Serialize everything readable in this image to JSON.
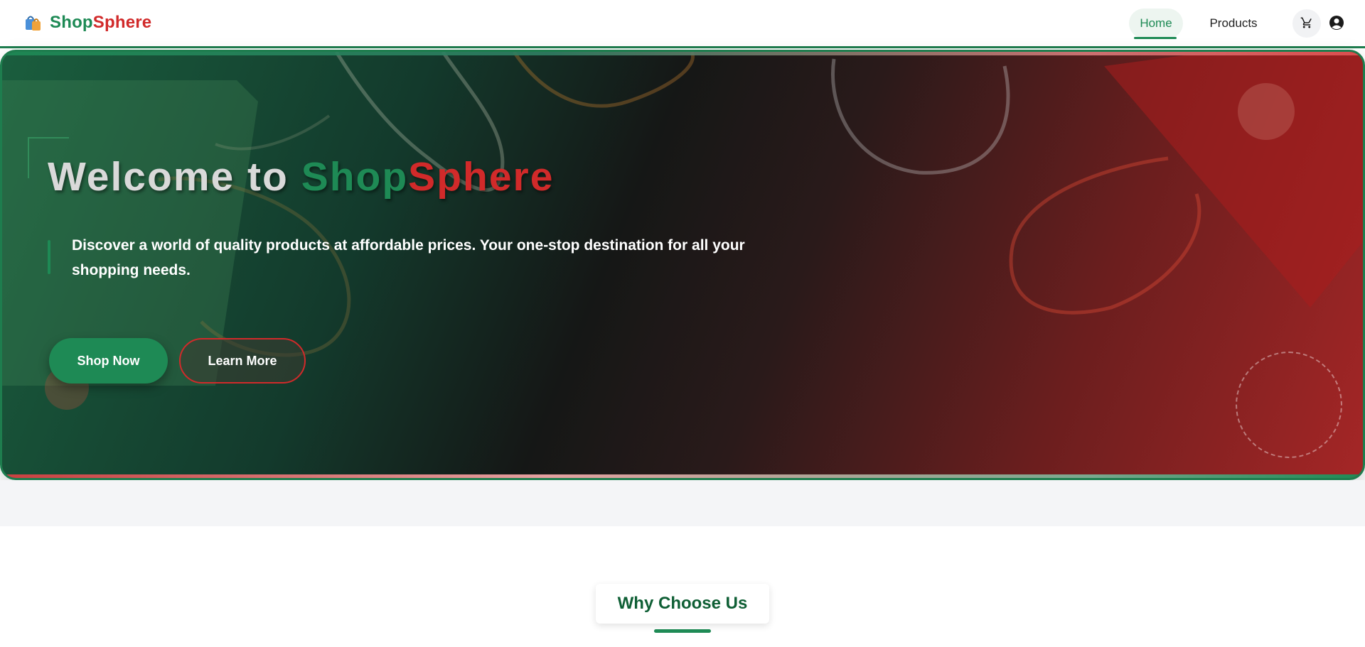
{
  "navbar": {
    "brand_shop": "Shop",
    "brand_sphere": "Sphere",
    "brand_icon": "shopping-bags-icon",
    "links": [
      {
        "label": "Home",
        "active": true
      },
      {
        "label": "Products",
        "active": false
      }
    ],
    "cart_icon": "cart-icon",
    "user_icon": "user-account-icon"
  },
  "hero": {
    "title_prefix": "Welcome to ",
    "title_shop": "Shop",
    "title_sphere": "Sphere",
    "subtitle": "Discover a world of quality products at affordable prices. Your one-stop destination for all your shopping needs.",
    "primary_button": "Shop Now",
    "secondary_button": "Learn More"
  },
  "section": {
    "title": "Why Choose Us"
  },
  "colors": {
    "brand_green": "#1e8a55",
    "brand_red": "#d12a2a",
    "dark_green_text": "#0f5f35"
  }
}
